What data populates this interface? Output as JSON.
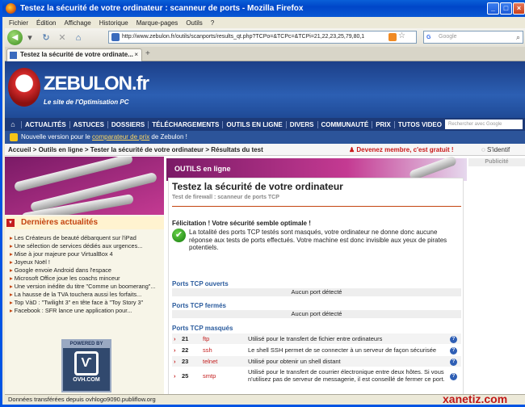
{
  "window": {
    "title": "Testez la sécurité de votre ordinateur : scanneur de ports - Mozilla Firefox"
  },
  "menu": [
    "Fichier",
    "Édition",
    "Affichage",
    "Historique",
    "Marque-pages",
    "Outils",
    "?"
  ],
  "url": "http://www.zebulon.fr/outils/scanports/results_qt.php?TCPo=&TCPc=&TCPi=21,22,23,25,79,80,1",
  "search_placeholder": "Google",
  "tab": {
    "label": "Testez la sécurité de votre ordinate...",
    "close": "×",
    "new": "+"
  },
  "site": {
    "logo": "ZEBULON.fr",
    "tagline": "Le site de l'Optimisation PC"
  },
  "mainnav": [
    "ACTUALITÉS",
    "ASTUCES",
    "DOSSIERS",
    "TÉLÉCHARGEMENTS",
    "OUTILS EN LIGNE",
    "DIVERS",
    "COMMUNAUTÉ",
    "PRIX",
    "TUTOS VIDEO"
  ],
  "navsearch_placeholder": "Rechercher avec Google",
  "promo": {
    "pre": "Nouvelle version pour le ",
    "link": "comparateur de prix",
    "post": " de Zebulon !"
  },
  "breadcrumb": "Accueil > Outils en ligne > Tester la sécurité de votre ordinateur > Résultats du test",
  "member": "Devenez membre, c'est gratuit !",
  "identify": "S'identif",
  "sidebar": {
    "section": "Dernières actualités",
    "news": [
      "Les Créateurs de beauté débarquent sur l'iPad",
      "Une sélection de services dédiés aux urgences...",
      "Mise à jour majeure pour VirtualBox 4",
      "Joyeux Noël !",
      "Google envoie Android dans l'espace",
      "Microsoft Office joue les coachs minceur",
      "Une version inédite du titre \"Comme un boomerang\"...",
      "La hausse de la TVA touchera aussi les forfaits...",
      "Top VàD : \"Twilight 3\" en tête face à \"Toy Story 3\"",
      "Facebook : SFR lance une application pour..."
    ],
    "powered": "POWERED BY",
    "host": "OVH.COM"
  },
  "main": {
    "banner": "OUTILS en ligne",
    "title": "Testez la sécurité de votre ordinateur",
    "subtitle": "Test de firewall : scanneur de ports TCP",
    "congrats": "Félicitation ! Votre sécurité semble optimale !",
    "desc": "La totalité des ports TCP testés sont masqués, votre ordinateur ne donne donc aucune réponse aux tests de ports effectués. Votre machine est donc invisible aux yeux de pirates potentiels.",
    "open_title": "Ports TCP ouverts",
    "open_none": "Aucun port détecté",
    "closed_title": "Ports TCP fermés",
    "closed_none": "Aucun port détecté",
    "masked_title": "Ports TCP masqués",
    "ports": [
      {
        "num": "21",
        "svc": "ftp",
        "desc": "Utilisé pour le transfert de fichier entre ordinateurs"
      },
      {
        "num": "22",
        "svc": "ssh",
        "desc": "Le shell SSH permet de se connecter à un serveur de façon sécurisée"
      },
      {
        "num": "23",
        "svc": "telnet",
        "desc": "Utilisé pour obtenir un shell distant"
      },
      {
        "num": "25",
        "svc": "smtp",
        "desc": "Utilisé pour le transfert de courrier électronique entre deux hôtes. Si vous n'utilisez pas de serveur de messagerie, il est conseillé de fermer ce port."
      }
    ]
  },
  "right": {
    "pub": "Publicité"
  },
  "status": "Données transférées depuis ovhlogo9090.publiflow.org",
  "watermark": "xanetiz.com"
}
